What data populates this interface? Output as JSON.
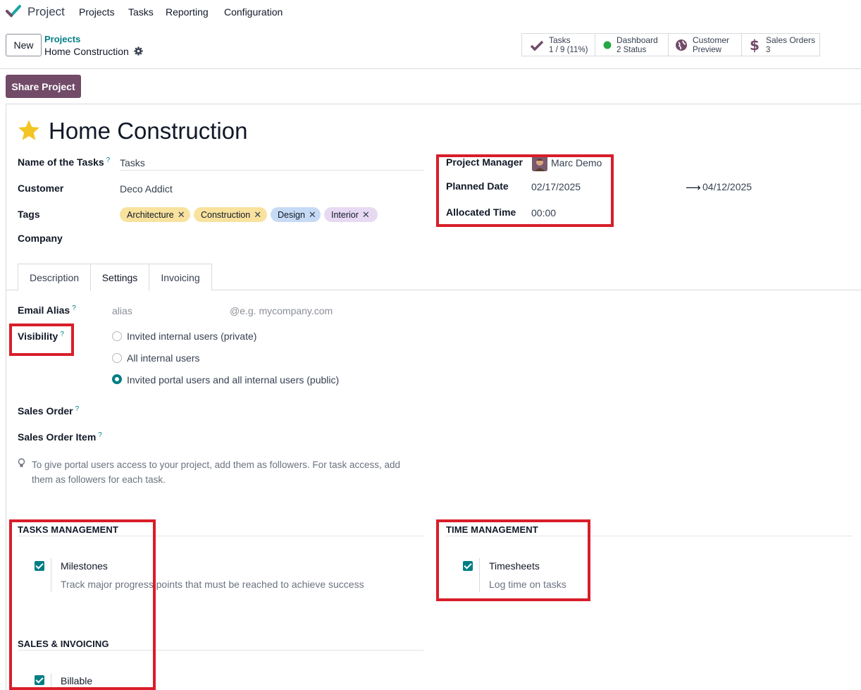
{
  "nav": {
    "app_name": "Project",
    "menu": [
      "Projects",
      "Tasks",
      "Reporting",
      "Configuration"
    ]
  },
  "control_panel": {
    "new_label": "New",
    "breadcrumb_parent": "Projects",
    "breadcrumb_current": "Home Construction",
    "stats": [
      {
        "label": "Tasks",
        "value": "1 / 9 (11%)",
        "icon": "check-icon"
      },
      {
        "label": "Dashboard",
        "value": "2 Status",
        "icon": "status-dot-icon"
      },
      {
        "label": "Customer",
        "value": "Preview",
        "icon": "globe-icon"
      },
      {
        "label": "Sales Orders",
        "value": "3",
        "icon": "dollar-icon"
      }
    ]
  },
  "share_label": "Share Project",
  "project": {
    "title": "Home Construction",
    "fields": {
      "name_of_tasks_label": "Name of the Tasks",
      "name_of_tasks_value": "Tasks",
      "customer_label": "Customer",
      "customer_value": "Deco Addict",
      "tags_label": "Tags",
      "company_label": "Company",
      "manager_label": "Project Manager",
      "manager_value": "Marc Demo",
      "planned_date_label": "Planned Date",
      "planned_start": "02/17/2025",
      "planned_end": "04/12/2025",
      "allocated_time_label": "Allocated Time",
      "allocated_time_value": "00:00"
    },
    "tags": [
      {
        "label": "Architecture",
        "color": "#f8e29d"
      },
      {
        "label": "Construction",
        "color": "#f8e29d"
      },
      {
        "label": "Design",
        "color": "#c6daf5"
      },
      {
        "label": "Interior",
        "color": "#e8d9f3"
      }
    ],
    "help_mark": "?"
  },
  "tabs": [
    "Description",
    "Settings",
    "Invoicing"
  ],
  "settings": {
    "email_alias_label": "Email Alias",
    "alias_placeholder": "alias",
    "alias_domain_placeholder": "@e.g. mycompany.com",
    "visibility_label": "Visibility",
    "visibility_options": [
      {
        "label": "Invited internal users (private)",
        "selected": false
      },
      {
        "label": "All internal users",
        "selected": false
      },
      {
        "label": "Invited portal users and all internal users (public)",
        "selected": true
      }
    ],
    "sales_order_label": "Sales Order",
    "sales_order_item_label": "Sales Order Item",
    "hint": "To give portal users access to your project, add them as followers. For task access, add them as followers for each task.",
    "tasks_management_title": "TASKS MANAGEMENT",
    "milestones_label": "Milestones",
    "milestones_desc": "Track major progress points that must be reached to achieve success",
    "time_management_title": "TIME MANAGEMENT",
    "timesheets_label": "Timesheets",
    "timesheets_desc": "Log time on tasks",
    "sales_invoicing_title": "SALES & INVOICING",
    "billable_label": "Billable"
  },
  "colors": {
    "brand": "#714b67",
    "accent": "#017e84",
    "highlight_box": "#d81e2a"
  }
}
